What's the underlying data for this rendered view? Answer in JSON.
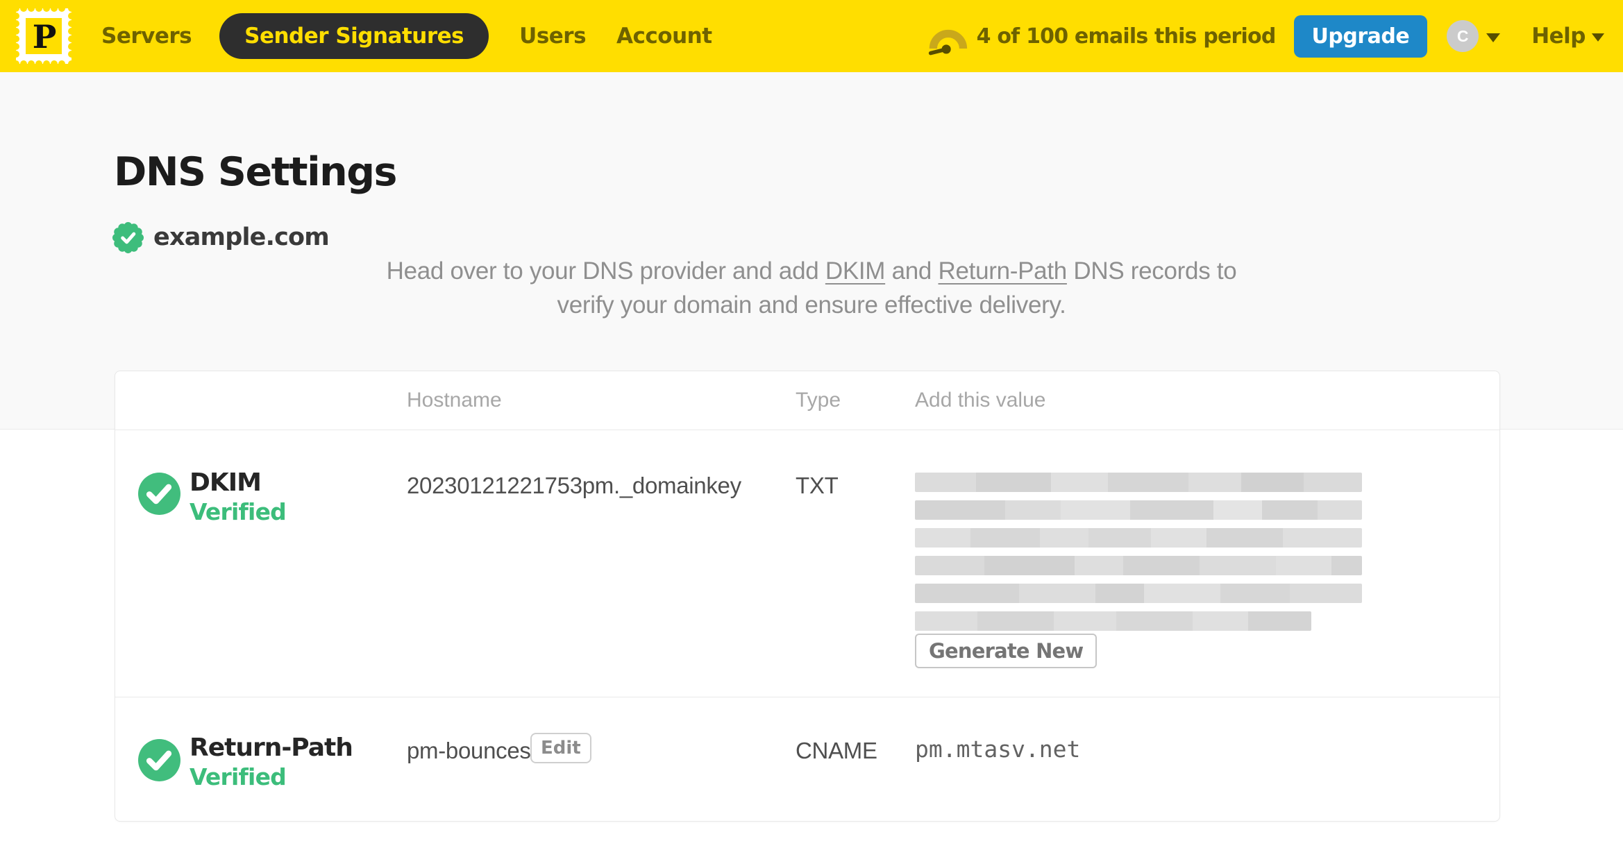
{
  "nav": {
    "logo_letter": "P",
    "items": [
      "Servers",
      "Sender Signatures",
      "Users",
      "Account"
    ],
    "active_item": "Sender Signatures",
    "usage_text": "4 of 100 emails this period",
    "upgrade_label": "Upgrade",
    "avatar_letter": "C",
    "help_label": "Help"
  },
  "page": {
    "title": "DNS Settings",
    "domain": "example.com",
    "intro": {
      "part1": "Head over to your DNS provider and add ",
      "link_dkim": "DKIM",
      "part2": " and ",
      "link_return_path": "Return-Path",
      "part3": " DNS records to",
      "line2": "verify your domain and ensure effective delivery."
    }
  },
  "table": {
    "headers": {
      "hostname": "Hostname",
      "type": "Type",
      "value": "Add this value"
    },
    "rows": [
      {
        "name": "DKIM",
        "status": "Verified",
        "hostname": "20230121221753pm._domainkey",
        "type": "TXT",
        "value_redacted": true,
        "action_label": "Generate New"
      },
      {
        "name": "Return-Path",
        "status": "Verified",
        "hostname": "pm-bounces",
        "edit_label": "Edit",
        "type": "CNAME",
        "value": "pm.mtasv.net"
      }
    ]
  },
  "icons": {
    "postmark-logo": "postage-stamp-with-P",
    "gauge-icon": "semicircle-usage-gauge",
    "verified-badge-icon": "green-rosette-check",
    "check-circle-icon": "green-circle-white-check",
    "chevron-down-icon": "solid-down-triangle"
  },
  "colors": {
    "nav_bg": "#FFDE00",
    "nav_text": "#6E6200",
    "active_pill_bg": "#2E2E2E",
    "active_pill_text": "#FFDE00",
    "upgrade_bg": "#1E88C8",
    "success_green": "#3CBD7B",
    "muted_text": "#8F8F8F",
    "page_bg": "#F9F9F9",
    "card_border": "#E8E8E8"
  }
}
